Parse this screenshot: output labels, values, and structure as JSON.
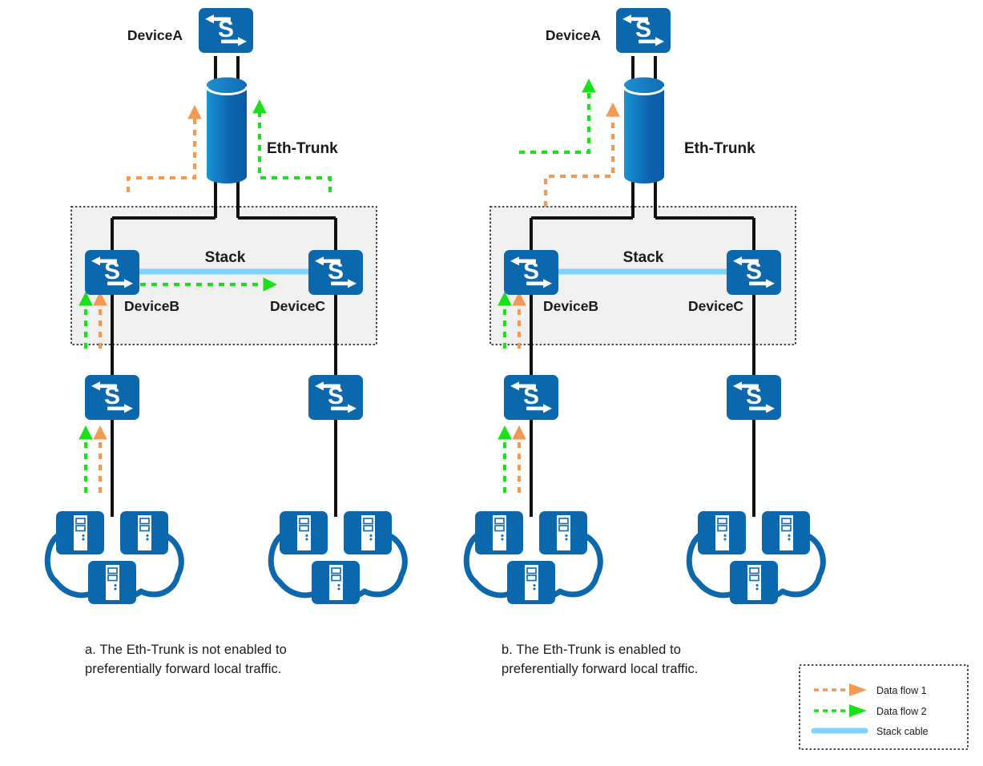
{
  "figure": {
    "title": "Eth-Trunk preferential local traffic forwarding",
    "colors": {
      "device_blue": "#0b68ad",
      "device_blue_dark": "#0a5f9e",
      "cylinder_light": "#1b8ed0",
      "cylinder_dark": "#0d5fa8",
      "stack_cable": "#7dd3fc",
      "data_flow_1": "#f29a53",
      "data_flow_2": "#19e019",
      "stack_bg": "#f0f0f0",
      "line_black": "#111111",
      "text": "#1a1a1a"
    }
  },
  "panels": [
    {
      "id": "a",
      "caption": "a. The Eth-Trunk is not enabled to\npreferentially forward local traffic.",
      "labels": {
        "device_a": "DeviceA",
        "device_b": "DeviceB",
        "device_c": "DeviceC",
        "eth_trunk": "Eth-Trunk",
        "stack": "Stack"
      },
      "stack_cable_arrow": true
    },
    {
      "id": "b",
      "caption": "b. The Eth-Trunk is enabled to\npreferentially forward local traffic.",
      "labels": {
        "device_a": "DeviceA",
        "device_b": "DeviceB",
        "device_c": "DeviceC",
        "eth_trunk": "Eth-Trunk",
        "stack": "Stack"
      },
      "stack_cable_arrow": false
    }
  ],
  "legend": {
    "items": [
      {
        "label": "Data flow 1",
        "style": "dashed-arrow",
        "color": "#f29a53"
      },
      {
        "label": "Data flow 2",
        "style": "dashed-arrow",
        "color": "#19e019"
      },
      {
        "label": "Stack cable",
        "style": "solid-line",
        "color": "#7dd3fc"
      }
    ]
  },
  "icons": {
    "switch": "switch-icon",
    "cylinder": "eth-trunk-cylinder-icon",
    "server": "server-icon",
    "server_group": "server-cloud-icon"
  }
}
